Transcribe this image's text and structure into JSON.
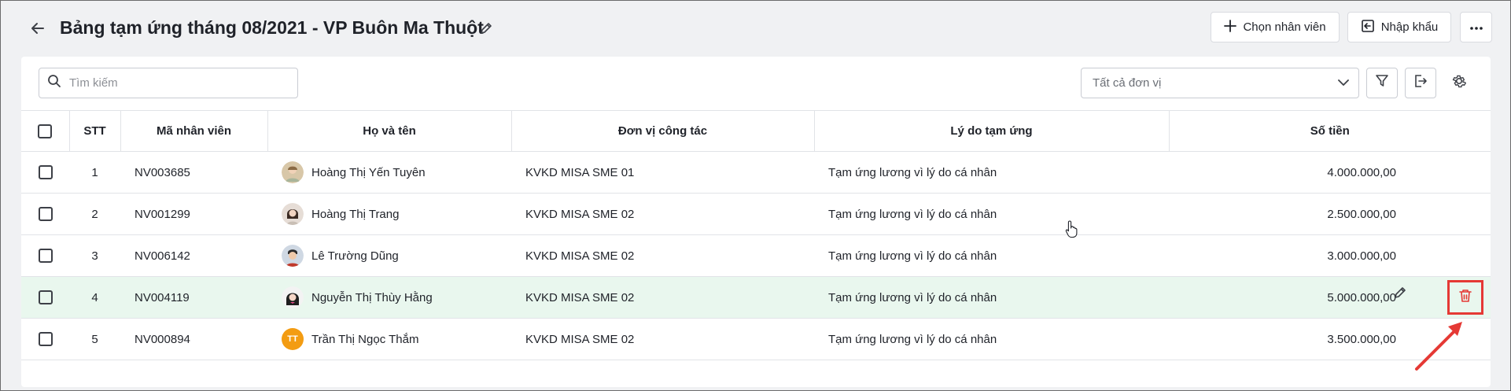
{
  "header": {
    "title": "Bảng tạm ứng tháng 08/2021 - VP Buôn Ma Thuột",
    "choose_employee_label": "Chọn nhân viên",
    "import_label": "Nhập khẩu"
  },
  "toolbar": {
    "search_placeholder": "Tìm kiếm",
    "unit_filter_value": "Tất cả đơn vị"
  },
  "table": {
    "columns": {
      "stt": "STT",
      "code": "Mã nhân viên",
      "name": "Họ và tên",
      "unit": "Đơn vị công tác",
      "reason": "Lý do tạm ứng",
      "amount": "Số tiền"
    },
    "rows": [
      {
        "stt": "1",
        "code": "NV003685",
        "name": "Hoàng Thị Yến Tuyên",
        "unit": "KVKD MISA SME 01",
        "reason": "Tạm ứng lương vì lý do cá nhân",
        "amount": "4.000.000,00"
      },
      {
        "stt": "2",
        "code": "NV001299",
        "name": "Hoàng Thị Trang",
        "unit": "KVKD MISA SME 02",
        "reason": "Tạm ứng lương vì lý do cá nhân",
        "amount": "2.500.000,00"
      },
      {
        "stt": "3",
        "code": "NV006142",
        "name": "Lê Trường Dũng",
        "unit": "KVKD MISA SME 02",
        "reason": "Tạm ứng lương vì lý do cá nhân",
        "amount": "3.000.000,00"
      },
      {
        "stt": "4",
        "code": "NV004119",
        "name": "Nguyễn Thị Thùy Hằng",
        "unit": "KVKD MISA SME 02",
        "reason": "Tạm ứng lương vì lý do cá nhân",
        "amount": "5.000.000,00"
      },
      {
        "stt": "5",
        "code": "NV000894",
        "name": "Trần Thị Ngọc Thắm",
        "unit": "KVKD MISA SME 02",
        "reason": "Tạm ứng lương vì lý do cá nhân",
        "amount": "3.500.000,00",
        "avatar_initials": "TT"
      }
    ]
  },
  "colors": {
    "selected_row": "#e9f7ee",
    "highlight": "#e53935",
    "avatar_initials_bg": "#f39c12"
  }
}
